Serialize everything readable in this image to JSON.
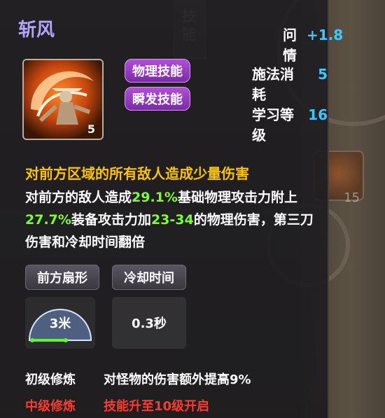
{
  "skill": {
    "name": "斩风",
    "level": "5",
    "tags": [
      "物理技能",
      "瞬发技能"
    ]
  },
  "stats": [
    {
      "label": "问情",
      "value": "+1.8"
    },
    {
      "label": "施法消耗",
      "value": "5"
    },
    {
      "label": "学习等级",
      "value": "16"
    }
  ],
  "summary": "对前方区域的所有敌人造成少量伤害",
  "description": {
    "p1": "对前方的敌人造成",
    "v1": "29.1%",
    "p2": "基础物理攻击力附上",
    "v2": "27.7%",
    "p3": "装备攻击力加",
    "v3": "23-34",
    "p4": "的物理伤害，第三刀伤害和冷却时间翻倍"
  },
  "range": {
    "label": "前方扇形",
    "value": "3米"
  },
  "cooldown": {
    "label": "冷却时间",
    "value": "0.3秒"
  },
  "masteries": [
    {
      "name": "初级修炼",
      "effect": "对怪物的伤害额外提高9%",
      "color": "#ffffff"
    },
    {
      "name": "中级修炼",
      "effect": "技能升至10级开启",
      "color": "#ff3b2f"
    }
  ],
  "background": {
    "side_tab": "技能",
    "side_skill_level": "15"
  },
  "colors": {
    "title": "#b6a4ff",
    "stat_value": "#3fc8ff",
    "summary": "#ffc400",
    "highlight": "#7cff34",
    "badge": "#9a3cc8"
  }
}
